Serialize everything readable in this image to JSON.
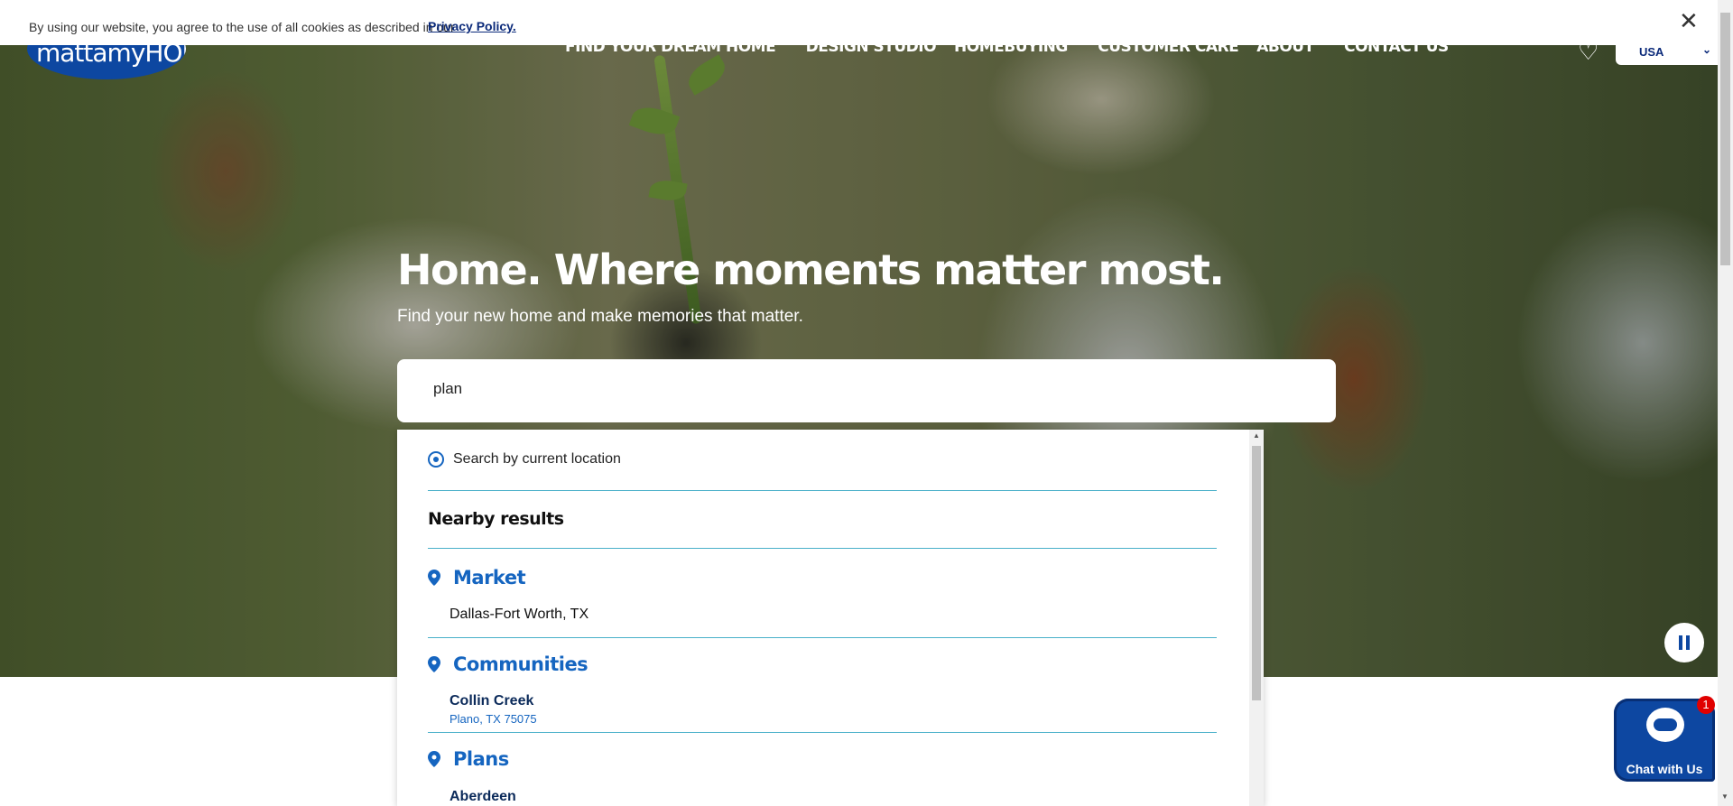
{
  "cookie": {
    "text": "By using our website, you agree to the use of all cookies as described in our",
    "link": "Privacy Policy.",
    "close": "✕"
  },
  "header": {
    "logo_text": "mattamyHOMES",
    "nav": [
      {
        "label": "FIND YOUR DREAM HOME",
        "has_menu": true
      },
      {
        "label": "DESIGN STUDIO",
        "has_menu": false
      },
      {
        "label": "HOMEBUYING",
        "has_menu": true
      },
      {
        "label": "CUSTOMER CARE",
        "has_menu": false
      },
      {
        "label": "ABOUT",
        "has_menu": true
      },
      {
        "label": "CONTACT US",
        "has_menu": false
      }
    ],
    "country": "USA"
  },
  "hero": {
    "title": "Home. Where moments matter most.",
    "subtitle": "Find your new home and make memories that matter."
  },
  "search": {
    "value": "plan",
    "location_option": "Search by current location",
    "nearby_heading": "Nearby results",
    "groups": {
      "market": {
        "title": "Market",
        "item": "Dallas-Fort Worth, TX"
      },
      "communities": {
        "title": "Communities",
        "item_name": "Collin Creek",
        "item_location": "Plano, TX 75075"
      },
      "plans": {
        "title": "Plans",
        "item_name": "Aberdeen"
      }
    }
  },
  "chat": {
    "label": "Chat with Us",
    "badge": "1"
  },
  "colors": {
    "brand_blue": "#0d47a1",
    "link_blue": "#1565c0",
    "divider": "#49b0c9"
  }
}
